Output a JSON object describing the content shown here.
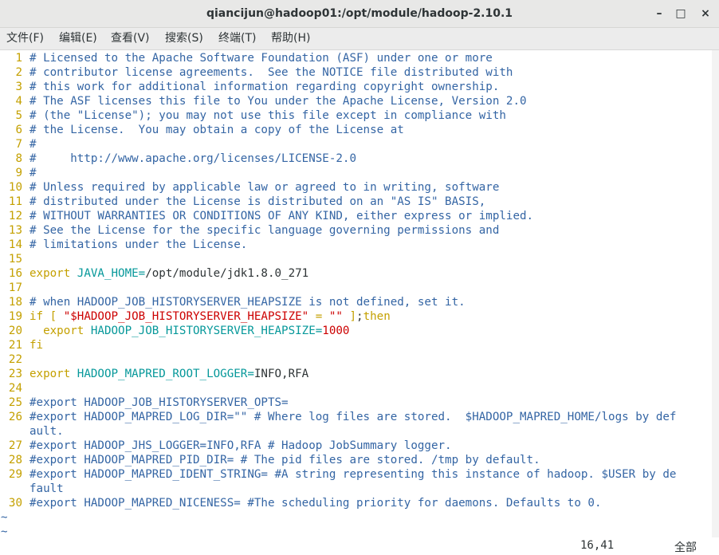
{
  "window": {
    "title": "qiancijun@hadoop01:/opt/module/hadoop-2.10.1",
    "controls": {
      "minimize": "–",
      "maximize": "□",
      "close": "×"
    }
  },
  "menu": [
    {
      "label": "文件(F)",
      "name": "menu-file"
    },
    {
      "label": "编辑(E)",
      "name": "menu-edit"
    },
    {
      "label": "查看(V)",
      "name": "menu-view"
    },
    {
      "label": "搜索(S)",
      "name": "menu-search"
    },
    {
      "label": "终端(T)",
      "name": "menu-terminal"
    },
    {
      "label": "帮助(H)",
      "name": "menu-help"
    }
  ],
  "editor": {
    "lines": [
      {
        "n": "1",
        "segs": [
          [
            "c",
            "# Licensed to the Apache Software Foundation (ASF) under one or more"
          ]
        ]
      },
      {
        "n": "2",
        "segs": [
          [
            "c",
            "# contributor license agreements.  See the NOTICE file distributed with"
          ]
        ]
      },
      {
        "n": "3",
        "segs": [
          [
            "c",
            "# this work for additional information regarding copyright ownership."
          ]
        ]
      },
      {
        "n": "4",
        "segs": [
          [
            "c",
            "# The ASF licenses this file to You under the Apache License, Version 2.0"
          ]
        ]
      },
      {
        "n": "5",
        "segs": [
          [
            "c",
            "# (the \"License\"); you may not use this file except in compliance with"
          ]
        ]
      },
      {
        "n": "6",
        "segs": [
          [
            "c",
            "# the License.  You may obtain a copy of the License at"
          ]
        ]
      },
      {
        "n": "7",
        "segs": [
          [
            "c",
            "#"
          ]
        ]
      },
      {
        "n": "8",
        "segs": [
          [
            "c",
            "#     http://www.apache.org/licenses/LICENSE-2.0"
          ]
        ]
      },
      {
        "n": "9",
        "segs": [
          [
            "c",
            "#"
          ]
        ]
      },
      {
        "n": "10",
        "segs": [
          [
            "c",
            "# Unless required by applicable law or agreed to in writing, software"
          ]
        ]
      },
      {
        "n": "11",
        "segs": [
          [
            "c",
            "# distributed under the License is distributed on an \"AS IS\" BASIS,"
          ]
        ]
      },
      {
        "n": "12",
        "segs": [
          [
            "c",
            "# WITHOUT WARRANTIES OR CONDITIONS OF ANY KIND, either express or implied."
          ]
        ]
      },
      {
        "n": "13",
        "segs": [
          [
            "c",
            "# See the License for the specific language governing permissions and"
          ]
        ]
      },
      {
        "n": "14",
        "segs": [
          [
            "c",
            "# limitations under the License."
          ]
        ]
      },
      {
        "n": "15",
        "segs": []
      },
      {
        "n": "16",
        "segs": [
          [
            "k",
            "export "
          ],
          [
            "v",
            "JAVA_HOME="
          ],
          [
            "p",
            "/opt/module/jdk1.8.0_271"
          ]
        ]
      },
      {
        "n": "17",
        "segs": []
      },
      {
        "n": "18",
        "segs": [
          [
            "c",
            "# when HADOOP_JOB_HISTORYSERVER_HEAPSIZE is not defined, set it."
          ]
        ]
      },
      {
        "n": "19",
        "segs": [
          [
            "k",
            "if [ "
          ],
          [
            "s",
            "\"$HADOOP_JOB_HISTORYSERVER_HEAPSIZE\""
          ],
          [
            "k",
            " = "
          ],
          [
            "s",
            "\"\""
          ],
          [
            "k",
            " ]"
          ],
          [
            "p",
            ";"
          ],
          [
            "k",
            "then"
          ]
        ]
      },
      {
        "n": "20",
        "segs": [
          [
            "k",
            "  export "
          ],
          [
            "v",
            "HADOOP_JOB_HISTORYSERVER_HEAPSIZE="
          ],
          [
            "s",
            "1000"
          ]
        ]
      },
      {
        "n": "21",
        "segs": [
          [
            "k",
            "fi"
          ]
        ]
      },
      {
        "n": "22",
        "segs": []
      },
      {
        "n": "23",
        "segs": [
          [
            "k",
            "export "
          ],
          [
            "v",
            "HADOOP_MAPRED_ROOT_LOGGER="
          ],
          [
            "p",
            "INFO,RFA"
          ]
        ]
      },
      {
        "n": "24",
        "segs": []
      },
      {
        "n": "25",
        "segs": [
          [
            "c",
            "#export HADOOP_JOB_HISTORYSERVER_OPTS="
          ]
        ]
      },
      {
        "n": "26",
        "segs": [
          [
            "c",
            "#export HADOOP_MAPRED_LOG_DIR=\"\" # Where log files are stored.  $HADOOP_MAPRED_HOME/logs by def"
          ]
        ]
      },
      {
        "n": "",
        "segs": [
          [
            "c",
            "ault."
          ]
        ]
      },
      {
        "n": "27",
        "segs": [
          [
            "c",
            "#export HADOOP_JHS_LOGGER=INFO,RFA # Hadoop JobSummary logger."
          ]
        ]
      },
      {
        "n": "28",
        "segs": [
          [
            "c",
            "#export HADOOP_MAPRED_PID_DIR= # The pid files are stored. /tmp by default."
          ]
        ]
      },
      {
        "n": "29",
        "segs": [
          [
            "c",
            "#export HADOOP_MAPRED_IDENT_STRING= #A string representing this instance of hadoop. $USER by de"
          ]
        ]
      },
      {
        "n": "",
        "segs": [
          [
            "c",
            "fault"
          ]
        ]
      },
      {
        "n": "30",
        "segs": [
          [
            "c",
            "#export HADOOP_MAPRED_NICENESS= #The scheduling priority for daemons. Defaults to 0."
          ]
        ]
      }
    ],
    "tildes": [
      "~",
      "~"
    ]
  },
  "status": {
    "position": "16,41",
    "scroll": "全部"
  },
  "colors": {
    "comment": "#3465a4",
    "keyword": "#c4a000",
    "variable": "#06989a",
    "string": "#cc0000",
    "text": "#2e3436",
    "line_number": "#c4a000"
  }
}
